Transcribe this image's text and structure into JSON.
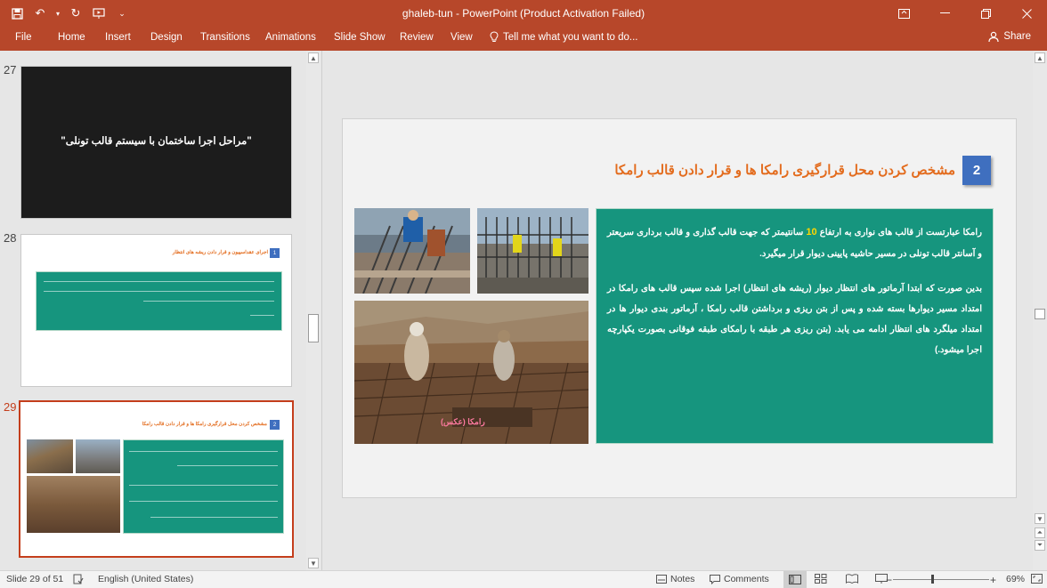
{
  "window": {
    "title": "ghaleb-tun  -  PowerPoint (Product Activation Failed)"
  },
  "ribbon": {
    "tabs": [
      "File",
      "Home",
      "Insert",
      "Design",
      "Transitions",
      "Animations",
      "Slide Show",
      "Review",
      "View"
    ],
    "tell_me": "Tell me what you want to do...",
    "share": "Share"
  },
  "thumbnails": [
    {
      "number": "27",
      "title": "\"مراحل اجرا ساختمان با سیستم قالب تونلی\""
    },
    {
      "number": "28",
      "title": "اجرای عقداسپیون و قرار دادن ریشه های انتظار",
      "badge": "1"
    },
    {
      "number": "29",
      "title": "مشخص کردن محل قرارگیری رامکا ها و قرار دادن قالب رامکا",
      "badge": "2"
    }
  ],
  "slide": {
    "number_badge": "2",
    "heading": "مشخص کردن محل قرارگیری رامکا ها و قرار دادن قالب رامکا",
    "para1_a": "رامکا عبارتست از قالب های نواری به ارتفاع ",
    "para1_num": "10",
    "para1_b": " سانتیمتر که جهت قالب گذاری و قالب برداری سریعتر و آسانتر قالب تونلی در مسیر حاشیه پایینی دیوار قرار میگیرد.",
    "para2": "بدین صورت که ابتدا آرماتور های انتظار دیوار (ریشه های انتظار) اجرا شده سپس قالب های رامکا در امتداد مسیر دیوارها بسته شده و پس از بتن ریزی و برداشتن قالب رامکا ، آرماتور بندی دیوار ها در امتداد میلگرد های انتظار ادامه می یابد. (بتن ریزی هر طبقه با رامکای طبقه فوقانی بصورت یکپارچه اجرا میشود.)",
    "photo_caption": "رامکا (عکس)"
  },
  "status": {
    "slide_of": "Slide 29 of 51",
    "language": "English (United States)",
    "notes": "Notes",
    "comments": "Comments",
    "zoom": "69%"
  },
  "colors": {
    "accent": "#b7472a",
    "heading": "#e36c1e",
    "badge": "#3f6fbf",
    "textbox": "#16957e"
  }
}
